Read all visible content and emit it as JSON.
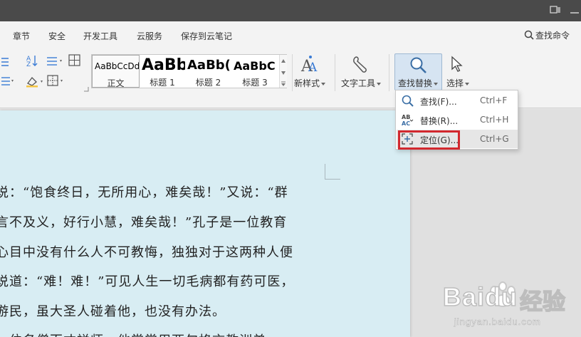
{
  "menubar": {
    "items": [
      "章节",
      "安全",
      "开发工具",
      "云服务",
      "保存到云笔记"
    ],
    "search_label": "查找命令"
  },
  "ribbon": {
    "styles": [
      {
        "sample": "AaBbCcDd",
        "name": "正文"
      },
      {
        "sample": "AaBb",
        "name": "标题 1"
      },
      {
        "sample": "AaBb(",
        "name": "标题 2"
      },
      {
        "sample": "AaBbC",
        "name": "标题 3"
      }
    ],
    "new_style_label": "新样式",
    "text_tool_label": "文字工具",
    "find_replace_label": "查找替换",
    "select_label": "选择"
  },
  "dropdown": {
    "items": [
      {
        "label": "查找(F)...",
        "shortcut": "Ctrl+F"
      },
      {
        "label": "替换(R)...",
        "shortcut": "Ctrl+H"
      },
      {
        "label": "定位(G)...",
        "shortcut": "Ctrl+G"
      }
    ]
  },
  "document": {
    "lines": [
      "说：“饱食终日，无所用心，难矣哉！”又说：“群",
      "言不及义，好行小慧，难矣哉！”孔子是一位教育",
      "心目中没有什么人不可教悔，独独对于这两种人便",
      "说道：“难！难！”可见人生一切毛病都有药可医，",
      "游民，虽大圣人碰着他，也没有办法。",
      "一位名僧百丈禅师，他常常用两句格言教训弟"
    ]
  },
  "watermark": {
    "brand": "Baidu",
    "cn": "经验",
    "url": "jingyan.baidu.com"
  },
  "colors": {
    "titlebar": "#4a4a4a",
    "page": "#d8edf3",
    "highlight": "#d2282e",
    "button_active": "#d6e4f2"
  }
}
